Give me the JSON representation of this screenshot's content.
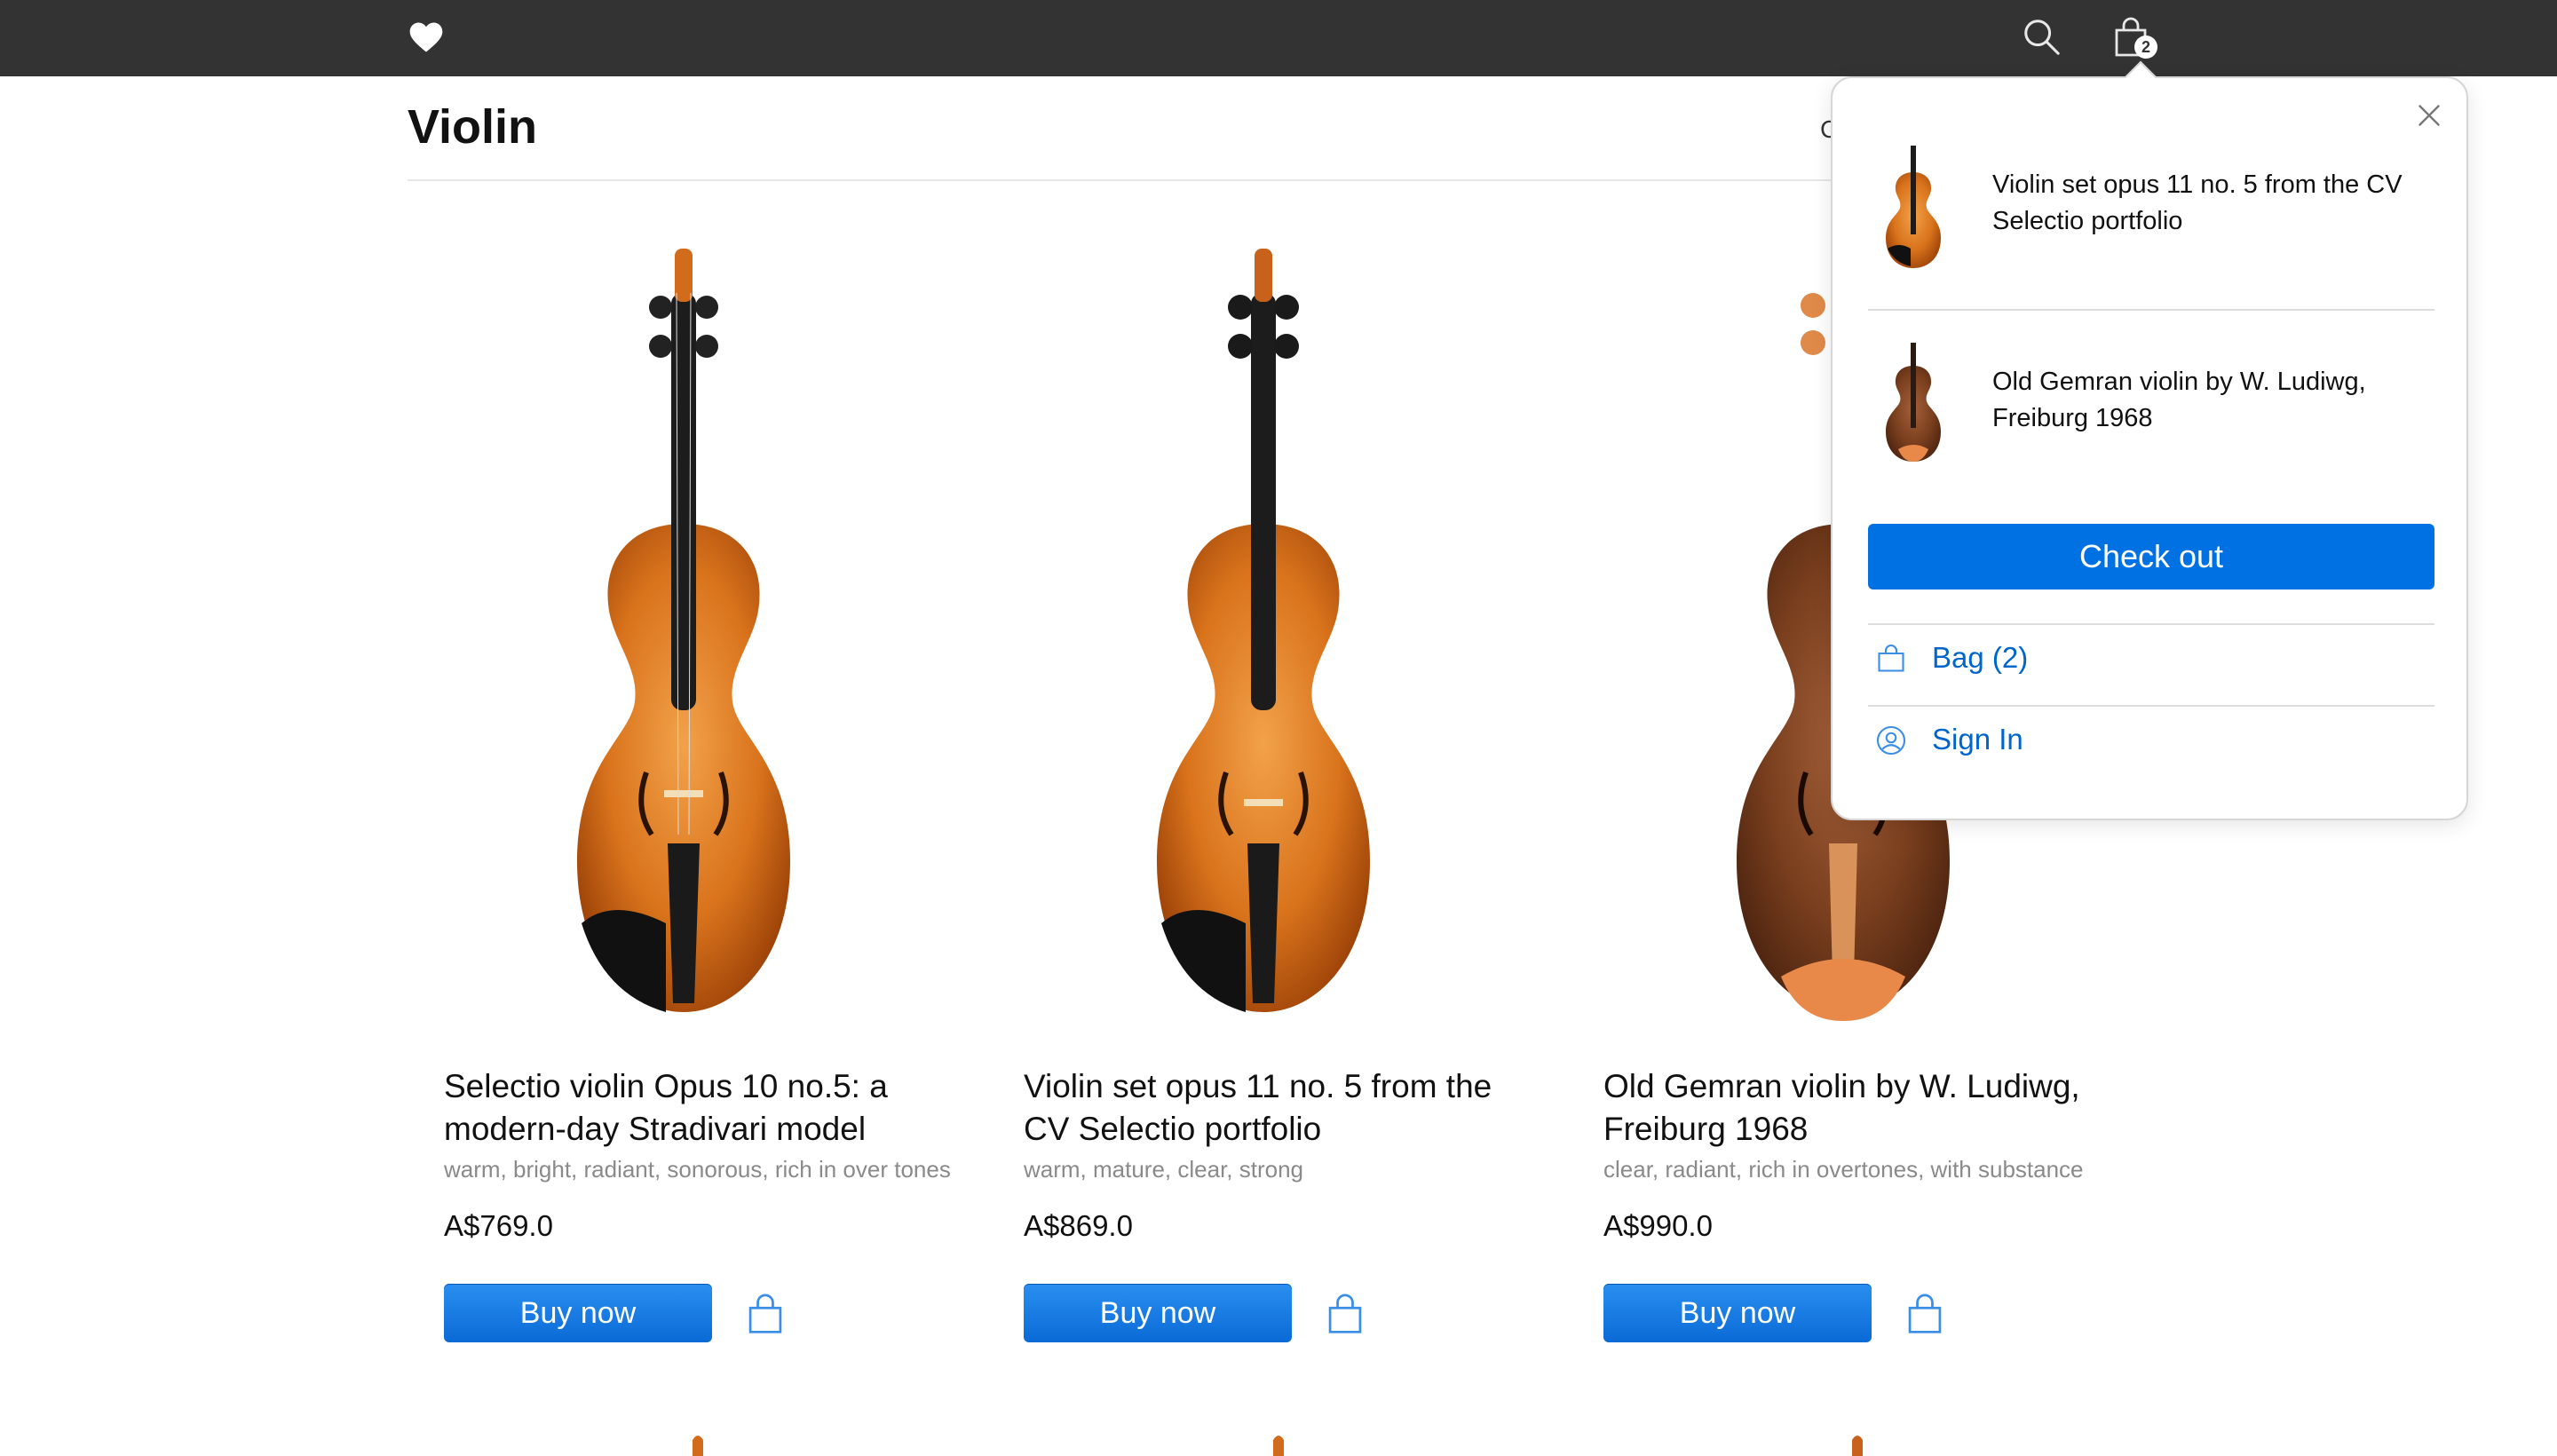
{
  "header": {
    "logo_icon": "heart-icon",
    "search_icon": "search-icon",
    "bag_icon": "shopping-bag-icon",
    "bag_count": "2",
    "bar_color": "#333333"
  },
  "page": {
    "title": "Violin",
    "peek_text": "C"
  },
  "products": [
    {
      "name": "Selectio violin Opus 10 no.5: a modern-day Stradivari model",
      "description": "warm, bright, radiant, sonorous, rich in over tones",
      "price": "A$769.0",
      "buy_label": "Buy now",
      "bag_icon": "shopping-bag-icon"
    },
    {
      "name": "Violin set opus 11 no. 5 from the CV Selectio portfolio",
      "description": "warm, mature, clear, strong",
      "price": "A$869.0",
      "buy_label": "Buy now",
      "bag_icon": "shopping-bag-icon"
    },
    {
      "name": "Old Gemran violin by W. Ludiwg, Freiburg 1968",
      "description": "clear, radiant, rich in overtones, with substance",
      "price": "A$990.0",
      "buy_label": "Buy now",
      "bag_icon": "shopping-bag-icon"
    }
  ],
  "bag_popover": {
    "close_icon": "close-icon",
    "items": [
      {
        "label": "Violin set opus 11 no. 5 from the CV Selectio portfolio"
      },
      {
        "label": "Old Gemran violin by W. Ludiwg, Freiburg 1968"
      }
    ],
    "checkout_label": "Check out",
    "links": [
      {
        "label": "Bag (2)",
        "icon": "shopping-bag-icon"
      },
      {
        "label": "Sign In",
        "icon": "user-circle-icon"
      }
    ],
    "accent_color": "#0071e3"
  }
}
